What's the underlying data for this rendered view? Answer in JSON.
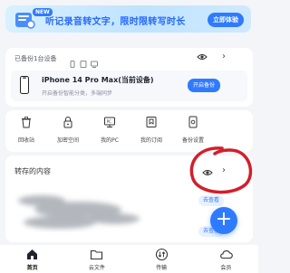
{
  "banner": {
    "badge": "NEW",
    "text": "听记录音转文字，限时限转写时长",
    "button": "立即体验"
  },
  "backup": {
    "header": "已备份1台设备",
    "device_name": "iPhone 14 Pro Max(当前设备)",
    "device_sub": "开启备份智能分类，多端同步",
    "button": "开启备份"
  },
  "tools": [
    {
      "label": "回收站",
      "icon": "trash-icon"
    },
    {
      "label": "加密空间",
      "icon": "lock-icon"
    },
    {
      "label": "我的PC",
      "icon": "pc-icon"
    },
    {
      "label": "我的订阅",
      "icon": "bookmark-icon"
    },
    {
      "label": "备份设置",
      "icon": "backup-settings-icon"
    }
  ],
  "saved": {
    "title": "转存的内容",
    "goto_labels": [
      "去查看",
      "去查看"
    ]
  },
  "tabs": [
    {
      "label": "首页",
      "icon": "home-icon",
      "active": true
    },
    {
      "label": "云文件",
      "icon": "folder-icon",
      "active": false
    },
    {
      "label": "传输",
      "icon": "transfer-icon",
      "active": false
    },
    {
      "label": "会员",
      "icon": "cloud-icon",
      "active": false
    }
  ],
  "colors": {
    "accent": "#2f7bff",
    "annotation": "#d21f2b"
  }
}
